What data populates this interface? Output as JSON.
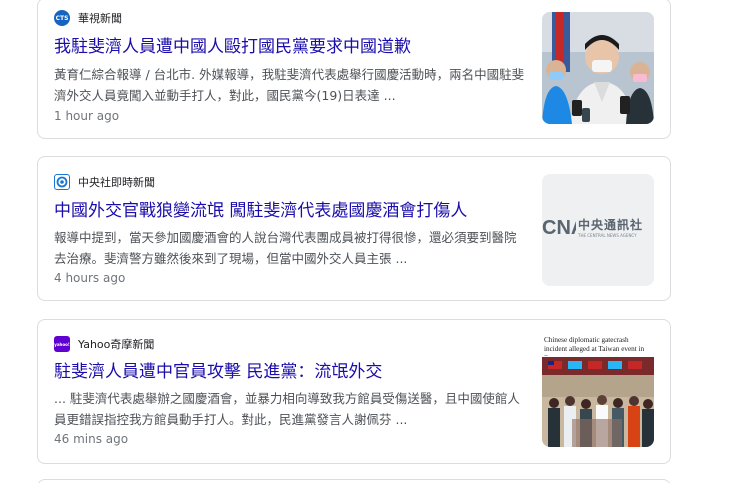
{
  "articles": [
    {
      "source": "華視新聞",
      "logo_text": "CTS",
      "headline": "我駐斐濟人員遭中國人毆打國民黨要求中國道歉",
      "snippet": "黃育仁綜合報導 / 台北市. 外媒報導，我駐斐濟代表處舉行國慶活動時，兩名中國駐斐濟外交人員竟闖入並動手打人，對此，國民黨今(19)日表達 ...",
      "time": "1 hour ago"
    },
    {
      "source": "中央社即時新聞",
      "headline": "中國外交官戰狼變流氓 闖駐斐濟代表處國慶酒會打傷人",
      "snippet": "報導中提到，當天參加國慶酒會的人說台灣代表團成員被打得很慘，還必須要到醫院去治療。斐濟警方雖然後來到了現場，但當中國外交人員主張 ...",
      "time": "4 hours ago",
      "thumb_brand": "中央通訊社",
      "thumb_brand_sub": "THE CENTRAL NEWS AGENCY"
    },
    {
      "source": "Yahoo奇摩新聞",
      "logo_text": "yahoo!",
      "headline": "駐斐濟人員遭中官員攻擊 民進黨：流氓外交",
      "snippet": "... 駐斐濟代表處舉辦之國慶酒會，並暴力相向導致我方館員受傷送醫，且中國使館人員更錯誤指控我方館員動手打人。對此，民進黨發言人謝佩芬 ...",
      "time": "46 mins ago",
      "thumb_caption": "Chinese diplomatic gatecrash incident alleged at Taiwan event in Suva"
    }
  ],
  "colors": {
    "link": "#1a0dab",
    "snippet": "#4d5156",
    "meta": "#70757a",
    "border": "#dadce0"
  }
}
